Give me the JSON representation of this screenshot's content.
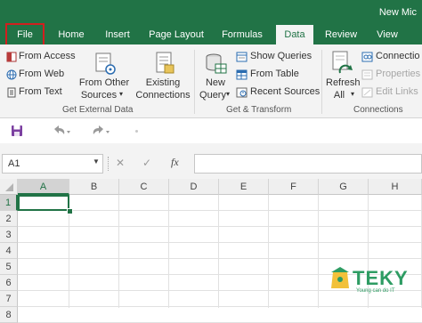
{
  "window": {
    "title": "New Mic"
  },
  "tabs": [
    {
      "label": "File"
    },
    {
      "label": "Home"
    },
    {
      "label": "Insert"
    },
    {
      "label": "Page Layout"
    },
    {
      "label": "Formulas"
    },
    {
      "label": "Data"
    },
    {
      "label": "Review"
    },
    {
      "label": "View"
    }
  ],
  "ribbon": {
    "get_external": {
      "from_access": "From Access",
      "from_web": "From Web",
      "from_text": "From Text",
      "from_other_1": "From Other",
      "from_other_2": "Sources",
      "existing_1": "Existing",
      "existing_2": "Connections",
      "label": "Get External Data"
    },
    "get_transform": {
      "new_1": "New",
      "new_2": "Query",
      "show_queries": "Show Queries",
      "from_table": "From Table",
      "recent_sources": "Recent Sources",
      "label": "Get & Transform"
    },
    "connections": {
      "refresh_1": "Refresh",
      "refresh_2": "All",
      "connections": "Connectio",
      "properties": "Properties",
      "edit_links": "Edit Links",
      "label": "Connections"
    }
  },
  "formula_bar": {
    "name_box": "A1",
    "cancel": "✕",
    "enter": "✓",
    "fx": "fx"
  },
  "grid": {
    "columns": [
      "A",
      "B",
      "C",
      "D",
      "E",
      "F",
      "G",
      "H"
    ],
    "rows": [
      "1",
      "2",
      "3",
      "4",
      "5",
      "6",
      "7",
      "8"
    ],
    "selected_cell": "A1"
  },
  "watermark": {
    "brand": "TEKY",
    "tagline": "Young can do IT"
  },
  "colors": {
    "excel_green": "#217346",
    "highlight_red": "#d21f1f"
  }
}
